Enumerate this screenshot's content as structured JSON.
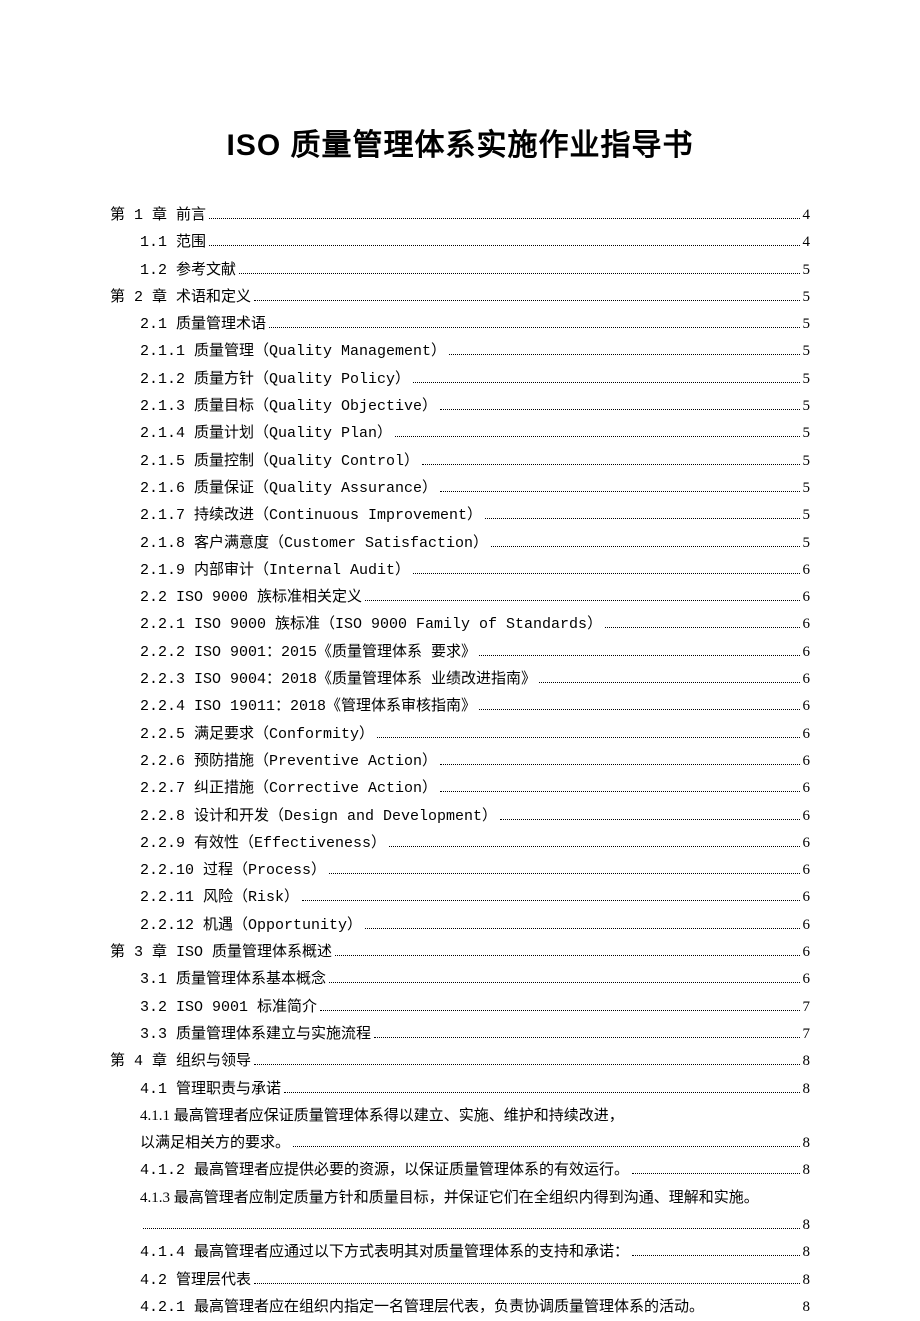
{
  "title": "ISO 质量管理体系实施作业指导书",
  "toc": [
    {
      "level": 1,
      "label": "第 1 章 前言",
      "page": "4"
    },
    {
      "level": 2,
      "label": "1.1 范围",
      "page": "4"
    },
    {
      "level": 2,
      "label": "1.2 参考文献",
      "page": "5"
    },
    {
      "level": 1,
      "label": "第 2 章 术语和定义",
      "page": "5"
    },
    {
      "level": 2,
      "label": "2.1 质量管理术语",
      "page": "5"
    },
    {
      "level": 2,
      "label": "2.1.1 质量管理（Quality Management）",
      "page": "5"
    },
    {
      "level": 2,
      "label": "2.1.2 质量方针（Quality Policy）",
      "page": "5"
    },
    {
      "level": 2,
      "label": "2.1.3 质量目标（Quality Objective）",
      "page": "5"
    },
    {
      "level": 2,
      "label": "2.1.4 质量计划（Quality Plan）",
      "page": "5"
    },
    {
      "level": 2,
      "label": "2.1.5 质量控制（Quality Control）",
      "page": "5"
    },
    {
      "level": 2,
      "label": "2.1.6 质量保证（Quality Assurance）",
      "page": "5"
    },
    {
      "level": 2,
      "label": "2.1.7 持续改进（Continuous Improvement）",
      "page": "5"
    },
    {
      "level": 2,
      "label": "2.1.8 客户满意度（Customer Satisfaction）",
      "page": "5"
    },
    {
      "level": 2,
      "label": "2.1.9 内部审计（Internal Audit）",
      "page": "6"
    },
    {
      "level": 2,
      "label": "2.2 ISO 9000 族标准相关定义",
      "page": "6"
    },
    {
      "level": 2,
      "label": "2.2.1 ISO 9000 族标准（ISO 9000 Family of Standards）",
      "page": "6"
    },
    {
      "level": 2,
      "label": "2.2.2 ISO 9001：2015《质量管理体系 要求》",
      "page": "6"
    },
    {
      "level": 2,
      "label": "2.2.3 ISO 9004：2018《质量管理体系 业绩改进指南》",
      "page": "6"
    },
    {
      "level": 2,
      "label": "2.2.4 ISO 19011：2018《管理体系审核指南》",
      "page": "6"
    },
    {
      "level": 2,
      "label": "2.2.5 满足要求（Conformity）",
      "page": "6"
    },
    {
      "level": 2,
      "label": "2.2.6 预防措施（Preventive Action）",
      "page": "6"
    },
    {
      "level": 2,
      "label": "2.2.7 纠正措施（Corrective Action）",
      "page": "6"
    },
    {
      "level": 2,
      "label": "2.2.8 设计和开发（Design and Development）",
      "page": "6"
    },
    {
      "level": 2,
      "label": "2.2.9 有效性（Effectiveness）",
      "page": "6"
    },
    {
      "level": 2,
      "label": "2.2.10 过程（Process）",
      "page": "6"
    },
    {
      "level": 2,
      "label": "2.2.11 风险（Risk）",
      "page": "6"
    },
    {
      "level": 2,
      "label": "2.2.12 机遇（Opportunity）",
      "page": "6"
    },
    {
      "level": 1,
      "label": "第 3 章 ISO 质量管理体系概述",
      "page": "6"
    },
    {
      "level": 2,
      "label": "3.1 质量管理体系基本概念",
      "page": "6"
    },
    {
      "level": 2,
      "label": "3.2 ISO 9001 标准简介",
      "page": "7"
    },
    {
      "level": 2,
      "label": "3.3 质量管理体系建立与实施流程",
      "page": "7"
    },
    {
      "level": 1,
      "label": "第 4 章 组织与领导",
      "page": "8"
    },
    {
      "level": 2,
      "label": "4.1 管理职责与承诺",
      "page": "8"
    },
    {
      "level": 2,
      "wrap": true,
      "label": "4.1.1 最高管理者应保证质量管理体系得以建立、实施、维护和持续改进，以满足相关方的要求。",
      "page": "8"
    },
    {
      "level": 2,
      "label": "4.1.2 最高管理者应提供必要的资源，以保证质量管理体系的有效运行。",
      "page": "8"
    },
    {
      "level": 2,
      "wrap": true,
      "label": "4.1.3 最高管理者应制定质量方针和质量目标，并保证它们在全组织内得到沟通、理解和实施。",
      "page": "8"
    },
    {
      "level": 2,
      "label": "4.1.4 最高管理者应通过以下方式表明其对质量管理体系的支持和承诺：",
      "page": "8"
    },
    {
      "level": 2,
      "label": "4.2 管理层代表",
      "page": "8"
    },
    {
      "level": 2,
      "label": "4.2.1 最高管理者应在组织内指定一名管理层代表，负责协调质量管理体系的活动。",
      "page": "8",
      "tight": true
    }
  ]
}
